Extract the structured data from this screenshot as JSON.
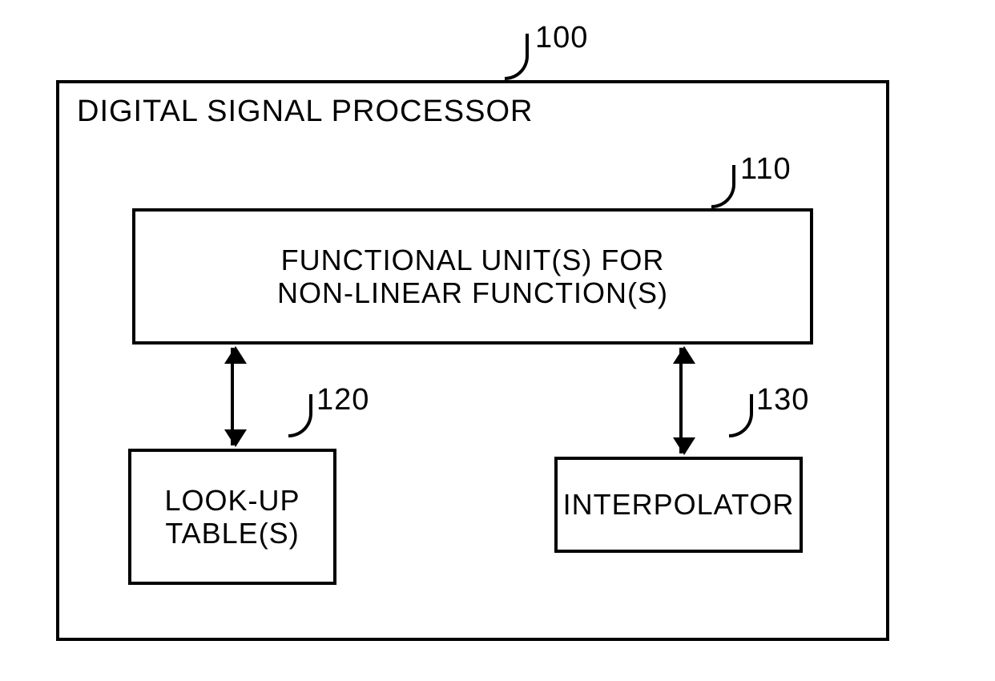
{
  "refs": {
    "outer": "100",
    "functional_unit": "110",
    "lookup_table": "120",
    "interpolator": "130"
  },
  "labels": {
    "outer_title": "DIGITAL SIGNAL PROCESSOR",
    "functional_unit_line1": "FUNCTIONAL UNIT(S) FOR",
    "functional_unit_line2": "NON-LINEAR FUNCTION(S)",
    "lookup_table_line1": "LOOK-UP",
    "lookup_table_line2": "TABLE(S)",
    "interpolator": "INTERPOLATOR"
  }
}
